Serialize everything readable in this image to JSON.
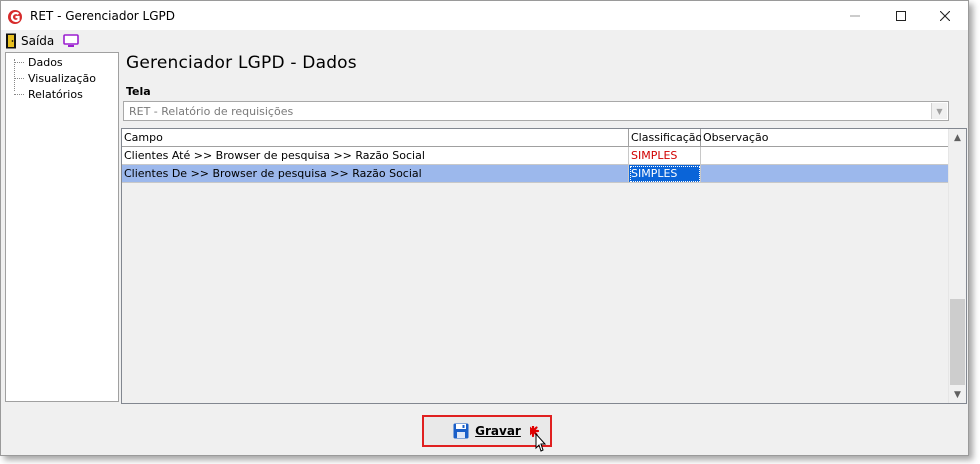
{
  "window": {
    "title": "RET - Gerenciador LGPD",
    "minimize": "minimize",
    "maximize": "maximize",
    "close": "close"
  },
  "menubar": {
    "exit_label": "Saída",
    "exit_icon": "door-exit-icon",
    "monitor_icon": "monitor-icon"
  },
  "tree": {
    "items": [
      {
        "label": "Dados"
      },
      {
        "label": "Visualização"
      },
      {
        "label": "Relatórios"
      }
    ]
  },
  "main": {
    "title": "Gerenciador LGPD - Dados",
    "tela_label": "Tela",
    "tela_value": "RET - Relatório de requisições"
  },
  "table": {
    "headers": [
      "Campo",
      "Classificação",
      "Observação"
    ],
    "rows": [
      {
        "campo": "Clientes Até >> Browser de pesquisa >> Razão Social",
        "classificacao": "SIMPLES",
        "observacao": "",
        "selected": false
      },
      {
        "campo": "Clientes De >> Browser de pesquisa >> Razão Social",
        "classificacao": "SIMPLES",
        "observacao": "",
        "selected": true
      }
    ]
  },
  "footer": {
    "save_label": "Gravar",
    "save_icon": "floppy-disk-icon"
  },
  "colors": {
    "accent_red": "#e02020",
    "selected_row": "#9cb8ec",
    "focus_cell": "#0a64d8",
    "classification_red": "#d00000"
  }
}
